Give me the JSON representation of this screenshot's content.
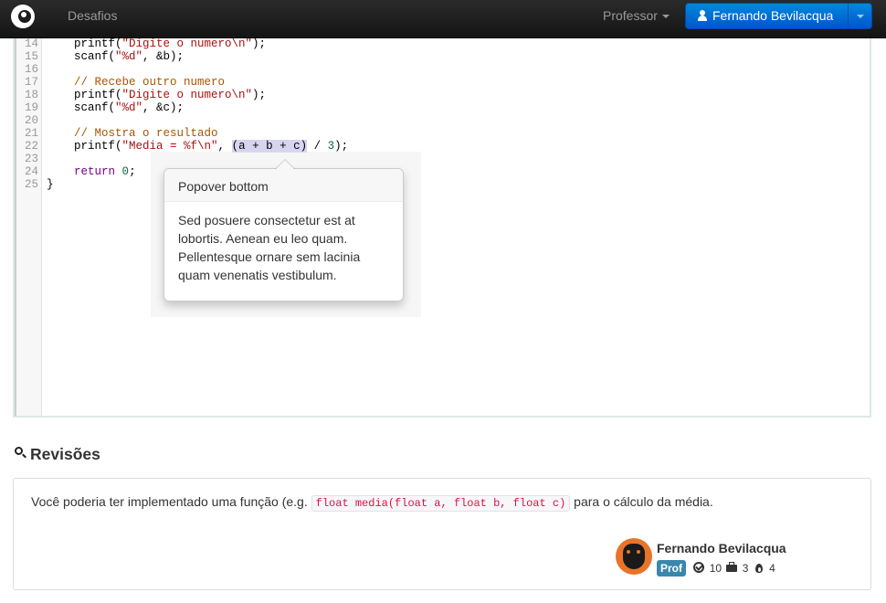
{
  "navbar": {
    "nav_desafios": "Desafios",
    "nav_professor": "Professor",
    "user_name": "Fernando Bevilacqua"
  },
  "editor": {
    "line_numbers": [
      "14",
      "15",
      "16",
      "17",
      "18",
      "19",
      "20",
      "21",
      "22",
      "23",
      "24",
      "25"
    ],
    "lines": [
      "    printf(\"Digite o numero\\n\");",
      "    scanf(\"%d\", &b);",
      "",
      "    // Recebe outro numero",
      "    printf(\"Digite o numero\\n\");",
      "    scanf(\"%d\", &c);",
      "",
      "    // Mostra o resultado",
      "    printf(\"Media = %f\\n\", (a + b + c) / 3);",
      "",
      "    return 0;",
      "}"
    ],
    "selected_text": "(a + b + c)"
  },
  "popover": {
    "title": "Popover bottom",
    "content": "Sed posuere consectetur est at lobortis. Aenean eu leo quam. Pellentesque ornare sem lacinia quam venenatis vestibulum."
  },
  "revisions": {
    "heading": "Revisões",
    "text_before": "Você poderia ter implementado uma função (e.g. ",
    "code": "float media(float a, float b, float c)",
    "text_after": " para o cálculo da média.",
    "author": {
      "name": "Fernando Bevilacqua",
      "role_badge": "Prof",
      "solved_count": "10",
      "projects_count": "3",
      "streak_count": "4"
    }
  },
  "colors": {
    "navbar_bg": "#1b1b1b",
    "user_button": "#006dcc",
    "badge_info": "#3a87ad",
    "code_string": "#aa1111",
    "code_comment": "#aa5500",
    "code_keyword": "#770088",
    "code_number": "#116644"
  },
  "icons": [
    "logo-icon",
    "user-icon",
    "chevron-down-icon",
    "zoom-in-icon",
    "ok-circle-icon",
    "briefcase-icon",
    "fire-icon"
  ]
}
